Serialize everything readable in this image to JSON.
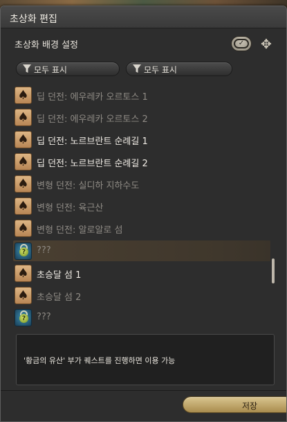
{
  "window": {
    "title": "초상화 편집"
  },
  "section": {
    "title": "초상화 배경 설정",
    "check_icon": "check-icon",
    "settings_icon": "settings-icon"
  },
  "filters": [
    {
      "label": "모두 표시",
      "icon": "filter-icon"
    },
    {
      "label": "모두 표시",
      "icon": "filter-icon"
    }
  ],
  "list": {
    "items": [
      {
        "label": "딥 던전: 에우레카 오르토스 1",
        "icon": "spade-card-icon",
        "state": "unavailable"
      },
      {
        "label": "딥 던전: 에우레카 오르토스 2",
        "icon": "spade-card-icon",
        "state": "unavailable"
      },
      {
        "label": "딥 던전: 노르브란트 순례길 1",
        "icon": "spade-card-icon",
        "state": "available"
      },
      {
        "label": "딥 던전: 노르브란트 순례길 2",
        "icon": "spade-card-icon",
        "state": "available"
      },
      {
        "label": "변형 던전: 실디하 지하수도",
        "icon": "spade-card-icon",
        "state": "unavailable"
      },
      {
        "label": "변형 던전: 육근산",
        "icon": "spade-card-icon",
        "state": "unavailable"
      },
      {
        "label": "변형 던전: 알로알로 섬",
        "icon": "spade-card-icon",
        "state": "unavailable"
      },
      {
        "label": "???",
        "icon": "unknown-item-icon",
        "state": "selected"
      },
      {
        "label": "초승달 섬 1",
        "icon": "spade-card-icon",
        "state": "available"
      },
      {
        "label": "초승달 섬 2",
        "icon": "spade-card-icon",
        "state": "unavailable"
      },
      {
        "label": "???",
        "icon": "unknown-item-icon",
        "state": "unavailable"
      }
    ]
  },
  "description": {
    "text": "'황금의 유산' 부가 퀘스트를 진행하면 이용 가능"
  },
  "footer": {
    "save_label": "저장"
  },
  "colors": {
    "window_bg": "#2d2d2d",
    "text_available": "#f1ede6",
    "text_unavailable": "#8e8a84",
    "selected_row": "#4a3f31",
    "save_button": "#c9b274"
  }
}
